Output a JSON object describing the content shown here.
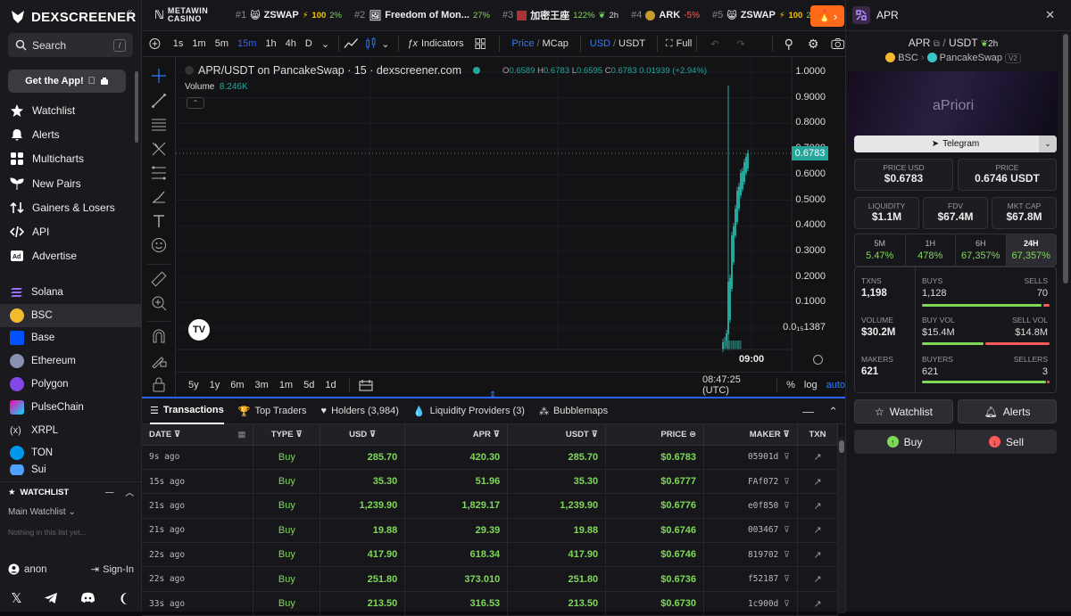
{
  "sidebar": {
    "brand": "DEXSCREENER",
    "search_label": "Search",
    "search_kbd": "/",
    "get_app": "Get the App!",
    "nav": [
      "Watchlist",
      "Alerts",
      "Multicharts",
      "New Pairs",
      "Gainers & Losers",
      "API",
      "Advertise"
    ],
    "chains": [
      "Solana",
      "BSC",
      "Base",
      "Ethereum",
      "Polygon",
      "PulseChain",
      "XRPL",
      "TON",
      "Sui"
    ],
    "watchlist_title": "WATCHLIST",
    "main_watchlist": "Main Watchlist",
    "watchlist_empty": "Nothing in this list yet...",
    "user": "anon",
    "signin": "Sign-In"
  },
  "ticker": {
    "ad": "METAWIN CASINO",
    "items": [
      {
        "rank": "#1",
        "name": "ZSWAP",
        "change": "100",
        "pct": "2%",
        "dir": "up",
        "bolt": true
      },
      {
        "rank": "#2",
        "name": "Freedom of Mon...",
        "change": "27%",
        "dir": "up"
      },
      {
        "rank": "#3",
        "name": "加密王座",
        "change": "122%",
        "extra": "2h",
        "dir": "up"
      },
      {
        "rank": "#4",
        "name": "ARK",
        "change": "-5%",
        "dir": "down"
      },
      {
        "rank": "#5",
        "name": "ZSWAP",
        "change": "100",
        "pct": "2",
        "dir": "up",
        "bolt": true
      }
    ]
  },
  "toolbar": {
    "timeframes": [
      "1s",
      "1m",
      "5m",
      "15m",
      "1h",
      "4h",
      "D"
    ],
    "selected_tf": "15m",
    "indicators": "Indicators",
    "price": "Price",
    "mcap": "MCap",
    "usd": "USD",
    "usdt": "USDT",
    "full": "Full"
  },
  "chart": {
    "title": "APR/USDT on PancakeSwap · 15 · dexscreener.com",
    "open": "0.6589",
    "high": "0.6783",
    "low": "0.6595",
    "close": "0.6783",
    "change": "0.01939 (+2.94%)",
    "volume_label": "Volume",
    "volume": "8.246K",
    "price_tag": "0.6783",
    "y_ticks": [
      "1.0000",
      "0.9000",
      "0.8000",
      "0.7000",
      "0.6000",
      "0.5000",
      "0.4000",
      "0.3000",
      "0.2000",
      "0.1000",
      "0.0₁₅1387"
    ],
    "time_label": "09:00",
    "ranges": [
      "5y",
      "1y",
      "6m",
      "3m",
      "1m",
      "5d",
      "1d"
    ],
    "clock": "08:47:25 (UTC)",
    "pct": "%",
    "log": "log",
    "auto": "auto"
  },
  "tabs": [
    "Transactions",
    "Top Traders",
    "Holders (3,984)",
    "Liquidity Providers (3)",
    "Bubblemaps"
  ],
  "table": {
    "headers": [
      "DATE",
      "TYPE",
      "USD",
      "APR",
      "USDT",
      "PRICE",
      "MAKER",
      "TXN"
    ],
    "rows": [
      {
        "date": "9s ago",
        "type": "Buy",
        "usd": "285.70",
        "apr": "420.30",
        "usdt": "285.70",
        "price": "$0.6783",
        "maker": "05901d"
      },
      {
        "date": "15s ago",
        "type": "Buy",
        "usd": "35.30",
        "apr": "51.96",
        "usdt": "35.30",
        "price": "$0.6777",
        "maker": "FAf072"
      },
      {
        "date": "21s ago",
        "type": "Buy",
        "usd": "1,239.90",
        "apr": "1,829.17",
        "usdt": "1,239.90",
        "price": "$0.6776",
        "maker": "e0f850"
      },
      {
        "date": "21s ago",
        "type": "Buy",
        "usd": "19.88",
        "apr": "29.39",
        "usdt": "19.88",
        "price": "$0.6746",
        "maker": "003467"
      },
      {
        "date": "22s ago",
        "type": "Buy",
        "usd": "417.90",
        "apr": "618.34",
        "usdt": "417.90",
        "price": "$0.6746",
        "maker": "819702"
      },
      {
        "date": "22s ago",
        "type": "Buy",
        "usd": "251.80",
        "apr": "373.010",
        "usdt": "251.80",
        "price": "$0.6736",
        "maker": "f52187"
      },
      {
        "date": "33s ago",
        "type": "Buy",
        "usd": "213.50",
        "apr": "316.53",
        "usdt": "213.50",
        "price": "$0.6730",
        "maker": "1c900d"
      }
    ]
  },
  "right": {
    "header": "APR",
    "base": "APR",
    "quote": "USDT",
    "age": "2h",
    "chain": "BSC",
    "dex": "PancakeSwap",
    "version": "V2",
    "banner_text": "aPriori",
    "telegram": "Telegram",
    "price_usd_label": "PRICE USD",
    "price_usd": "$0.6783",
    "price_label": "PRICE",
    "price_usdt": "0.6746 USDT",
    "liquidity_label": "LIQUIDITY",
    "liquidity": "$1.1M",
    "fdv_label": "FDV",
    "fdv": "$67.4M",
    "mcap_label": "MKT CAP",
    "mcap": "$67.8M",
    "periods": [
      {
        "label": "5M",
        "value": "5.47%"
      },
      {
        "label": "1H",
        "value": "478%"
      },
      {
        "label": "6H",
        "value": "67,357%"
      },
      {
        "label": "24H",
        "value": "67,357%"
      }
    ],
    "txns_label": "TXNS",
    "txns": "1,198",
    "buys_label": "BUYS",
    "buys": "1,128",
    "sells_label": "SELLS",
    "sells": "70",
    "volume_label": "VOLUME",
    "volume": "$30.2M",
    "buyvol_label": "BUY VOL",
    "buyvol": "$15.4M",
    "sellvol_label": "SELL VOL",
    "sellvol": "$14.8M",
    "makers_label": "MAKERS",
    "makers": "621",
    "buyers_label": "BUYERS",
    "buyers": "621",
    "sellers_label": "SELLERS",
    "sellers": "3",
    "watchlist": "Watchlist",
    "alerts": "Alerts",
    "buy": "Buy",
    "sell": "Sell"
  },
  "colors": {
    "up": "#26a69a",
    "buy_green": "#7ed957",
    "sell_red": "#ff5a5a",
    "accent": "#2962ff"
  }
}
